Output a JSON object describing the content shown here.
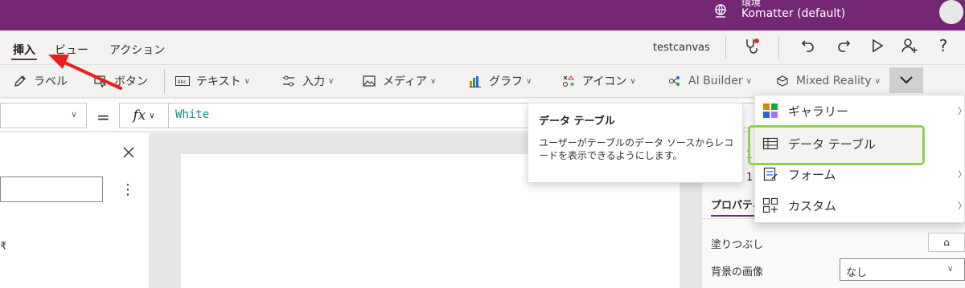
{
  "topbar": {
    "env_small": "環境",
    "env_name": "Komatter (default)",
    "bg_color": "#742774"
  },
  "header": {
    "tabs": [
      {
        "label": "挿入",
        "active": true
      },
      {
        "label": "ビュー",
        "active": false
      },
      {
        "label": "アクション",
        "active": false
      }
    ],
    "app_name": "testcanvas",
    "icons": [
      "stethoscope-icon",
      "undo-icon",
      "redo-icon",
      "play-icon",
      "share-user-icon",
      "help-icon"
    ]
  },
  "ribbon": {
    "items": [
      {
        "label": "ラベル",
        "icon": "pencil-icon",
        "dropdown": false
      },
      {
        "label": "ボタン",
        "icon": "cursor-icon",
        "dropdown": false
      },
      {
        "label": "テキスト",
        "icon": "text-abc-icon",
        "dropdown": true
      },
      {
        "label": "入力",
        "icon": "sliders-icon",
        "dropdown": true
      },
      {
        "label": "メディア",
        "icon": "image-icon",
        "dropdown": true
      },
      {
        "label": "グラフ",
        "icon": "bar-chart-icon",
        "dropdown": true
      },
      {
        "label": "アイコン",
        "icon": "icons-icon",
        "dropdown": true
      },
      {
        "label": "AI Builder",
        "icon": "ai-icon",
        "dropdown": true
      },
      {
        "label": "Mixed Reality",
        "icon": "mixed-reality-icon",
        "dropdown": true
      }
    ],
    "more_icon": "chevron-down-icon"
  },
  "formula_bar": {
    "property_value": "",
    "equals": "=",
    "fx": "fx",
    "formula": "White"
  },
  "tooltip": {
    "title": "データ テーブル",
    "body": "ユーザーがテーブルのデータ ソースからレコードを表示できるようにします。"
  },
  "menu": {
    "items": [
      {
        "label": "ギャラリー",
        "icon": "gallery-icon",
        "has_submenu": true
      },
      {
        "label": "データ テーブル",
        "icon": "table-icon",
        "has_submenu": false,
        "highlighted": true
      },
      {
        "label": "フォーム",
        "icon": "form-icon",
        "has_submenu": true
      },
      {
        "label": "カスタム",
        "icon": "custom-icon",
        "has_submenu": true
      }
    ],
    "highlight_color": "#92d050"
  },
  "right_panel": {
    "tab_label": "プロパティ",
    "fill_label": "塗りつぶし",
    "bg_image_label": "背景の画像",
    "bg_image_value": "なし",
    "fragment_1": "1",
    "fragment_2": "1"
  },
  "left_panel": {
    "fragment": "₹"
  },
  "annotation": {
    "arrow_color": "#e8201a"
  }
}
